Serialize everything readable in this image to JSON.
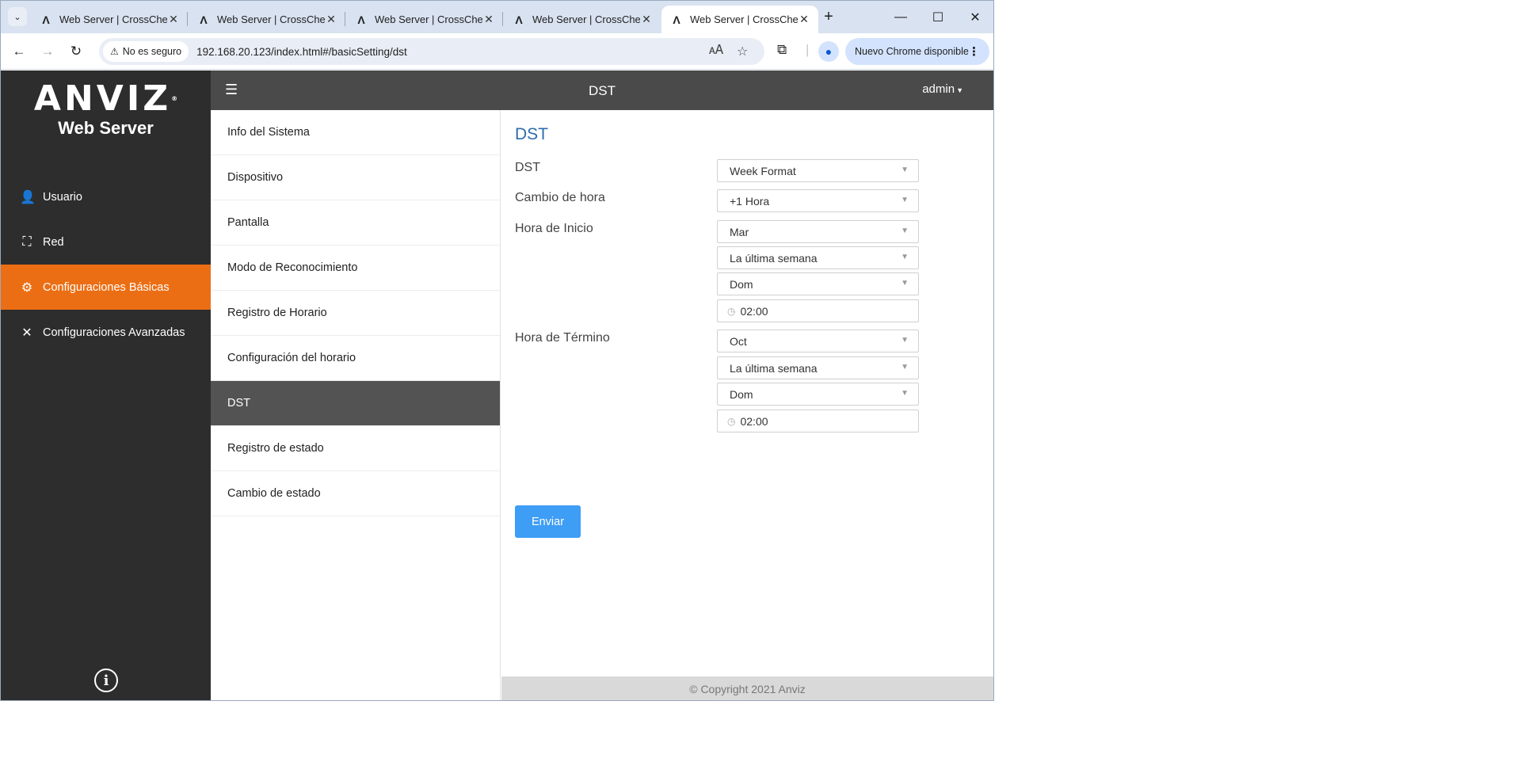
{
  "browser": {
    "tabs": [
      {
        "title": "Web Server | CrossChex",
        "active": false
      },
      {
        "title": "Web Server | CrossChex",
        "active": false
      },
      {
        "title": "Web Server | CrossChex",
        "active": false
      },
      {
        "title": "Web Server | CrossChex",
        "active": false
      },
      {
        "title": "Web Server | CrossChex",
        "active": true
      }
    ],
    "security_chip": "No es seguro",
    "url": "192.168.20.123/index.html#/basicSetting/dst",
    "update_chip": "Nuevo Chrome disponible"
  },
  "app": {
    "logo": {
      "brand": "ANVIZ",
      "registered": "®",
      "subtitle": "Web Server"
    },
    "sidebar": [
      {
        "label": "Usuario",
        "icon": "user-icon",
        "active": false
      },
      {
        "label": "Red",
        "icon": "network-icon",
        "active": false
      },
      {
        "label": "Configuraciones Básicas",
        "icon": "gear-icon",
        "active": true
      },
      {
        "label": "Configuraciones Avanzadas",
        "icon": "tools-icon",
        "active": false
      }
    ],
    "topbar": {
      "title": "DST",
      "user": "admin"
    },
    "submenu": [
      {
        "label": "Info del Sistema",
        "active": false
      },
      {
        "label": "Dispositivo",
        "active": false
      },
      {
        "label": "Pantalla",
        "active": false
      },
      {
        "label": "Modo de Reconocimiento",
        "active": false
      },
      {
        "label": "Registro de Horario",
        "active": false
      },
      {
        "label": "Configuración del horario",
        "active": false
      },
      {
        "label": "DST",
        "active": true
      },
      {
        "label": "Registro de estado",
        "active": false
      },
      {
        "label": "Cambio de estado",
        "active": false
      }
    ],
    "form": {
      "heading": "DST",
      "dst_label": "DST",
      "dst_value": "Week Format",
      "shift_label": "Cambio de hora",
      "shift_value": "+1 Hora",
      "start_label": "Hora de Inicio",
      "start_month": "Mar",
      "start_week": "La última semana",
      "start_day": "Dom",
      "start_time": "02:00",
      "end_label": "Hora de Término",
      "end_month": "Oct",
      "end_week": "La última semana",
      "end_day": "Dom",
      "end_time": "02:00",
      "submit": "Enviar"
    },
    "footer": "© Copyright 2021 Anviz"
  },
  "colors": {
    "sidebar_bg": "#2d2d2d",
    "active_orange": "#ec6e14",
    "topbar_bg": "#4a4a4a",
    "submenu_active": "#535353",
    "heading_blue": "#2b6cb0",
    "button_blue": "#3e9df5"
  }
}
